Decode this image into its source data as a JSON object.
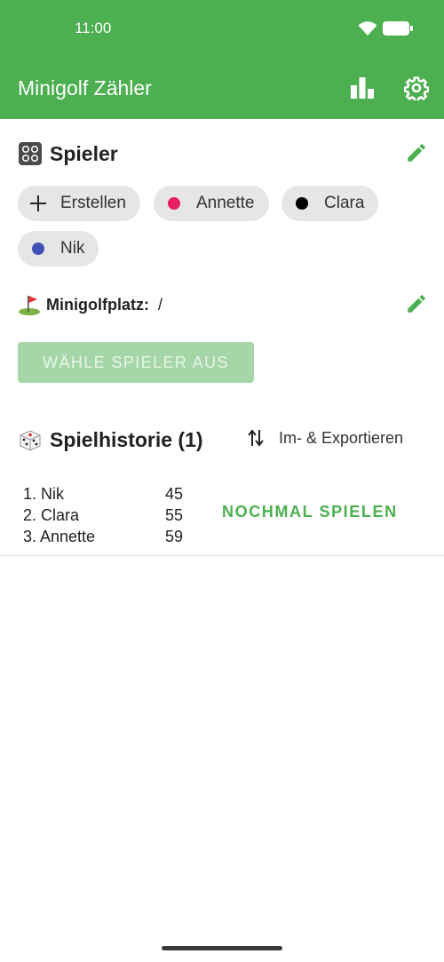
{
  "status_bar": {
    "time": "11:00"
  },
  "app_bar": {
    "title": "Minigolf Zähler",
    "stats_icon": "bar-chart-icon",
    "settings_icon": "gear-icon"
  },
  "colors": {
    "primary": "#4caf50",
    "primary_light": "#a5d6a7",
    "chip_bg": "#e6e6e6"
  },
  "players_section": {
    "title": "Spieler",
    "icon": "people-emoji",
    "create_label": "Erstellen",
    "players": [
      {
        "name": "Annette",
        "color": "#e91e63"
      },
      {
        "name": "Clara",
        "color": "#000000"
      },
      {
        "name": "Nik",
        "color": "#3f51b5"
      }
    ]
  },
  "course": {
    "label": "Minigolfplatz:",
    "value": "/",
    "icon": "golf-flag-emoji"
  },
  "select_players_button": "WÄHLE SPIELER AUS",
  "history": {
    "title": "Spielhistorie (1)",
    "icon": "die-emoji",
    "import_export_label": "Im- & Exportieren",
    "games": [
      {
        "ranking": [
          {
            "rank": "1. Nik",
            "score": "45"
          },
          {
            "rank": "2. Clara",
            "score": "55"
          },
          {
            "rank": "3. Annette",
            "score": "59"
          }
        ],
        "replay_label": "NOCHMAL SPIELEN"
      }
    ]
  }
}
